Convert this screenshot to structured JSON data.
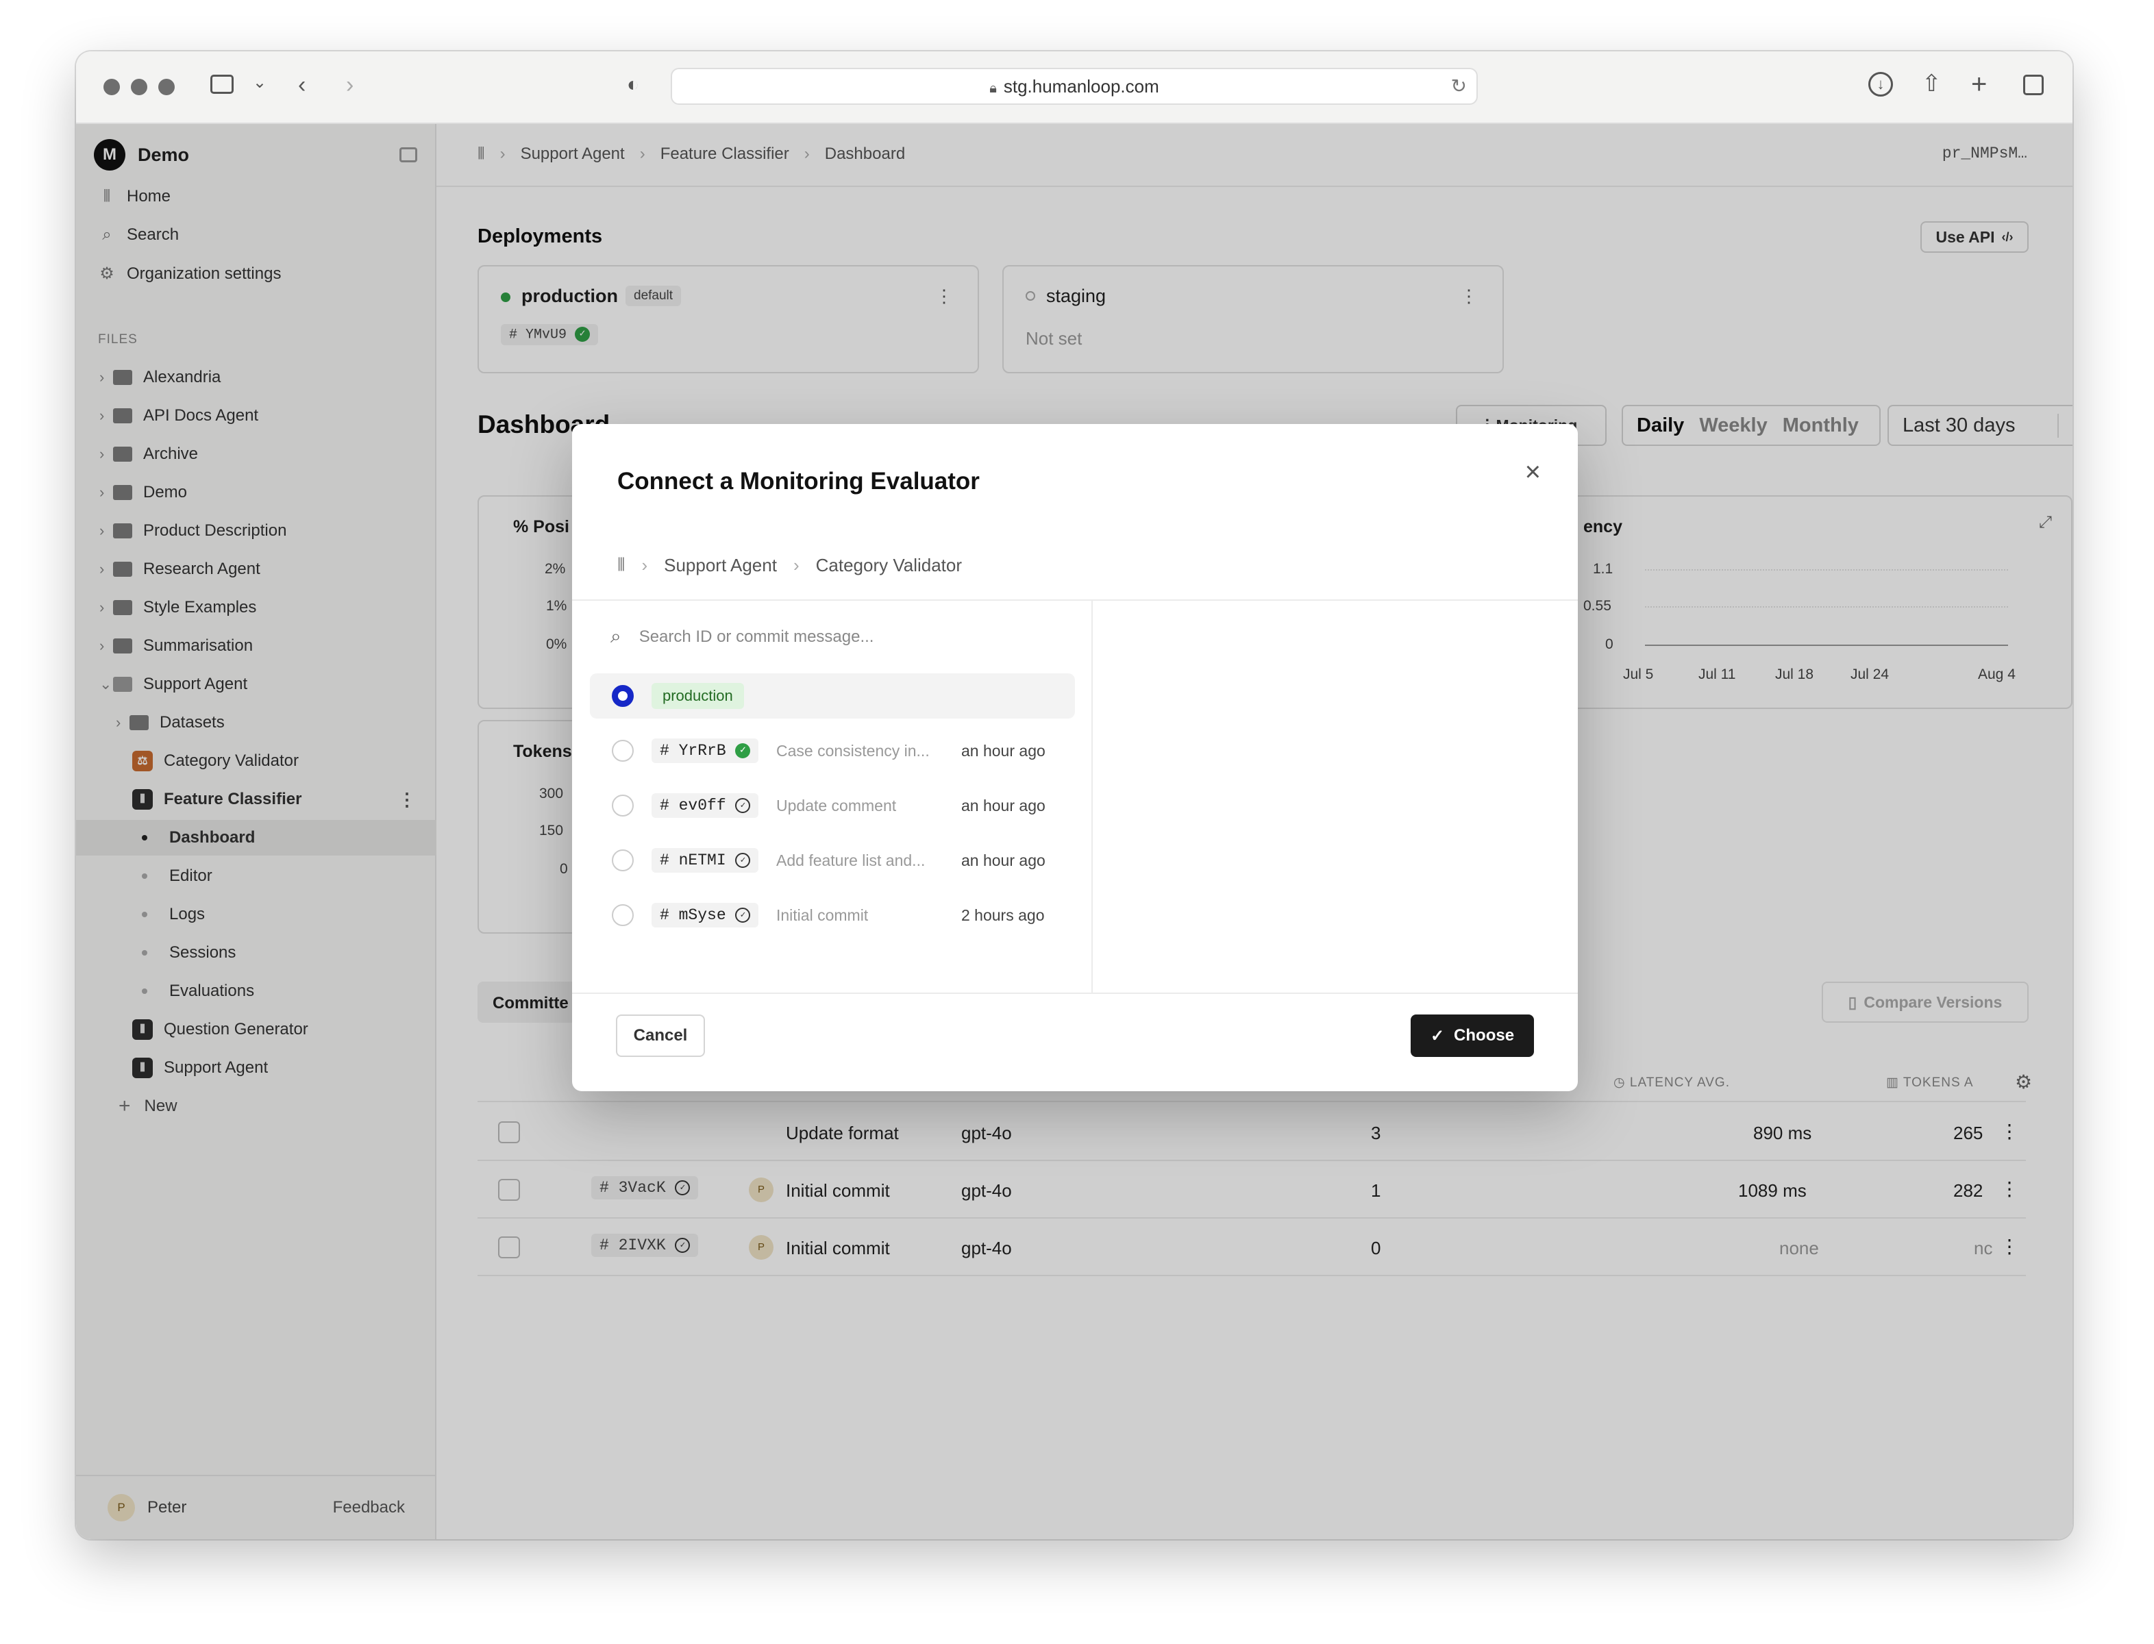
{
  "browser": {
    "url": "stg.humanloop.com"
  },
  "sidebar": {
    "workspace": "Demo",
    "nav": [
      {
        "label": "Home"
      },
      {
        "label": "Search"
      },
      {
        "label": "Organization settings"
      }
    ],
    "files_heading": "FILES",
    "folders": [
      {
        "label": "Alexandria"
      },
      {
        "label": "API Docs Agent"
      },
      {
        "label": "Archive"
      },
      {
        "label": "Demo"
      },
      {
        "label": "Product Description"
      },
      {
        "label": "Research Agent"
      },
      {
        "label": "Style Examples"
      },
      {
        "label": "Summarisation"
      },
      {
        "label": "Support Agent"
      }
    ],
    "support_children": [
      {
        "label": "Datasets"
      },
      {
        "label": "Category Validator"
      },
      {
        "label": "Feature Classifier"
      }
    ],
    "feature_children": [
      {
        "label": "Dashboard"
      },
      {
        "label": "Editor"
      },
      {
        "label": "Logs"
      },
      {
        "label": "Sessions"
      },
      {
        "label": "Evaluations"
      }
    ],
    "more_files": [
      {
        "label": "Question Generator"
      },
      {
        "label": "Support Agent"
      }
    ],
    "new_label": "New",
    "user": "Peter",
    "user_initial": "P",
    "feedback": "Feedback"
  },
  "header": {
    "crumbs": [
      "Support Agent",
      "Feature Classifier",
      "Dashboard"
    ],
    "project_id": "pr_NMPsM…"
  },
  "deployments": {
    "title": "Deployments",
    "use_api": "Use API",
    "production": {
      "name": "production",
      "badge": "default",
      "version": "YMvU9"
    },
    "staging": {
      "name": "staging",
      "value": "Not set"
    }
  },
  "dashboard": {
    "title": "Dashboard",
    "monitoring": "Monitoring",
    "periods": [
      "Daily",
      "Weekly",
      "Monthly"
    ],
    "range": "Last 30 days",
    "chart1": {
      "title_part": "% Posi",
      "ticks": [
        "2%",
        "1%",
        "0%"
      ]
    },
    "chart3": {
      "title_part": "ency",
      "ticks": [
        "1.1",
        "0.55",
        "0"
      ],
      "x": [
        "Jul 5",
        "Jul 11",
        "Jul 18",
        "Jul 24",
        "Aug 4"
      ]
    },
    "chart4": {
      "title_part": "Tokens",
      "ticks": [
        "300",
        "150",
        "0"
      ]
    }
  },
  "versions": {
    "tab": "Committe",
    "compare": "Compare Versions",
    "col_latency": "LATENCY AVG.",
    "col_tokens": "TOKENS A",
    "rows": [
      {
        "id": "",
        "message": "Update format",
        "model": "gpt-4o",
        "count": "3",
        "latency": "890 ms",
        "tokens": "265"
      },
      {
        "id": "3VacK",
        "message": "Initial commit",
        "model": "gpt-4o",
        "count": "1",
        "latency": "1089 ms",
        "tokens": "282"
      },
      {
        "id": "2IVXK",
        "message": "Initial commit",
        "model": "gpt-4o",
        "count": "0",
        "latency": "none",
        "tokens": "nc"
      }
    ]
  },
  "modal": {
    "title": "Connect a Monitoring Evaluator",
    "crumbs": [
      "Support Agent",
      "Category Validator"
    ],
    "search_placeholder": "Search ID or commit message...",
    "selected_label": "production",
    "options": [
      {
        "id": "YrRrB",
        "message": "Case consistency in...",
        "when": "an hour ago",
        "status": "deployed"
      },
      {
        "id": "ev0ff",
        "message": "Update comment",
        "when": "an hour ago",
        "status": "committed"
      },
      {
        "id": "nETMI",
        "message": "Add feature list and...",
        "when": "an hour ago",
        "status": "committed"
      },
      {
        "id": "mSyse",
        "message": "Initial commit",
        "when": "2 hours ago",
        "status": "committed"
      }
    ],
    "cancel": "Cancel",
    "choose": "Choose"
  }
}
